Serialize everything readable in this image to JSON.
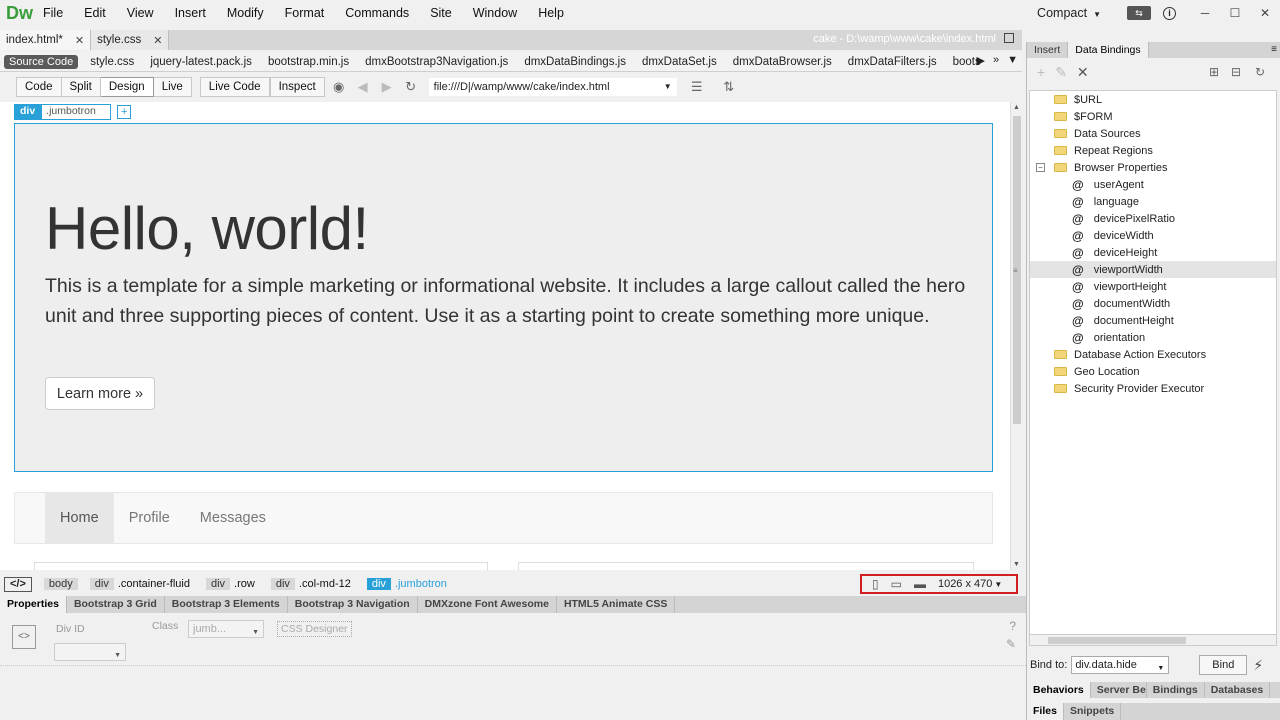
{
  "app": {
    "logo": "Dw",
    "menu": [
      "File",
      "Edit",
      "View",
      "Insert",
      "Modify",
      "Format",
      "Commands",
      "Site",
      "Window",
      "Help"
    ],
    "workspace": "Compact",
    "window_controls": [
      "─",
      "☐",
      "✕"
    ]
  },
  "doc_tabs": {
    "tabs": [
      {
        "label": "index.html*",
        "active": true
      },
      {
        "label": "style.css",
        "active": false
      }
    ],
    "path": "cake - D:\\wamp\\www\\cake\\index.html"
  },
  "related_files": {
    "source_code": "Source Code",
    "files": [
      "style.css",
      "jquery-latest.pack.js",
      "bootstrap.min.js",
      "dmxBootstrap3Navigation.js",
      "dmxDataBindings.js",
      "dmxDataSet.js",
      "dmxDataBrowser.js",
      "dmxDataFilters.js",
      "boots"
    ]
  },
  "toolbar": {
    "view_buttons": [
      "Code",
      "Split",
      "Design",
      "Live"
    ],
    "active_view": "Design",
    "live_code": "Live Code",
    "inspect": "Inspect",
    "address": "file:///D|/wamp/www/cake/index.html"
  },
  "canvas": {
    "element_tag": "div",
    "element_class": ".jumbotron",
    "plus": "+",
    "heading": "Hello, world!",
    "paragraph": "This is a template for a simple marketing or informational website. It includes a large callout called the hero unit and three supporting pieces of content. Use it as a starting point to create something more unique.",
    "button": "Learn more »",
    "nav": [
      "Home",
      "Profile",
      "Messages"
    ]
  },
  "statusbar": {
    "code_tag": "</>",
    "crumbs": [
      {
        "tag": "body",
        "cls": ""
      },
      {
        "tag": "div",
        "cls": ".container-fluid"
      },
      {
        "tag": "div",
        "cls": ".row"
      },
      {
        "tag": "div",
        "cls": ".col-md-12"
      },
      {
        "tag": "div",
        "cls": ".jumbotron"
      }
    ],
    "size": "1026 x 470"
  },
  "properties": {
    "tabs": [
      "Properties",
      "Bootstrap 3 Grid",
      "Bootstrap 3 Elements",
      "Bootstrap 3 Navigation",
      "DMXzone Font Awesome",
      "HTML5 Animate CSS"
    ],
    "div_id_label": "Div ID",
    "class_label": "Class",
    "class_value": "jumb...",
    "css_designer": "CSS Designer",
    "tag_icon": "<>"
  },
  "right_panel": {
    "tabs": [
      "Insert",
      "Data Bindings"
    ],
    "active_tab": "Data Bindings",
    "tree": [
      {
        "label": "$URL",
        "type": "folder",
        "level": 0
      },
      {
        "label": "$FORM",
        "type": "folder",
        "level": 0
      },
      {
        "label": "Data Sources",
        "type": "folder",
        "level": 0
      },
      {
        "label": "Repeat Regions",
        "type": "folder",
        "level": 0
      },
      {
        "label": "Browser Properties",
        "type": "folder",
        "level": 0,
        "expanded": true
      },
      {
        "label": "userAgent",
        "type": "prop",
        "level": 1
      },
      {
        "label": "language",
        "type": "prop",
        "level": 1
      },
      {
        "label": "devicePixelRatio",
        "type": "prop",
        "level": 1
      },
      {
        "label": "deviceWidth",
        "type": "prop",
        "level": 1
      },
      {
        "label": "deviceHeight",
        "type": "prop",
        "level": 1
      },
      {
        "label": "viewportWidth",
        "type": "prop",
        "level": 1,
        "selected": true
      },
      {
        "label": "viewportHeight",
        "type": "prop",
        "level": 1
      },
      {
        "label": "documentWidth",
        "type": "prop",
        "level": 1
      },
      {
        "label": "documentHeight",
        "type": "prop",
        "level": 1
      },
      {
        "label": "orientation",
        "type": "prop",
        "level": 1
      },
      {
        "label": "Database Action Executors",
        "type": "folder",
        "level": 0
      },
      {
        "label": "Geo Location",
        "type": "folder",
        "level": 0
      },
      {
        "label": "Security Provider Executor",
        "type": "folder",
        "level": 0
      }
    ],
    "bind_to_label": "Bind to:",
    "bind_to_value": "div.data.hide",
    "bind_button": "Bind",
    "bottom_tabs": [
      "Behaviors",
      "Server Beh",
      "Bindings",
      "Databases"
    ],
    "bottom_tabs2": [
      "Files",
      "Snippets"
    ]
  },
  "colors": {
    "selection": "#29a0d8",
    "highlight_box": "#d21e1e",
    "logo": "#3a9e3a"
  }
}
